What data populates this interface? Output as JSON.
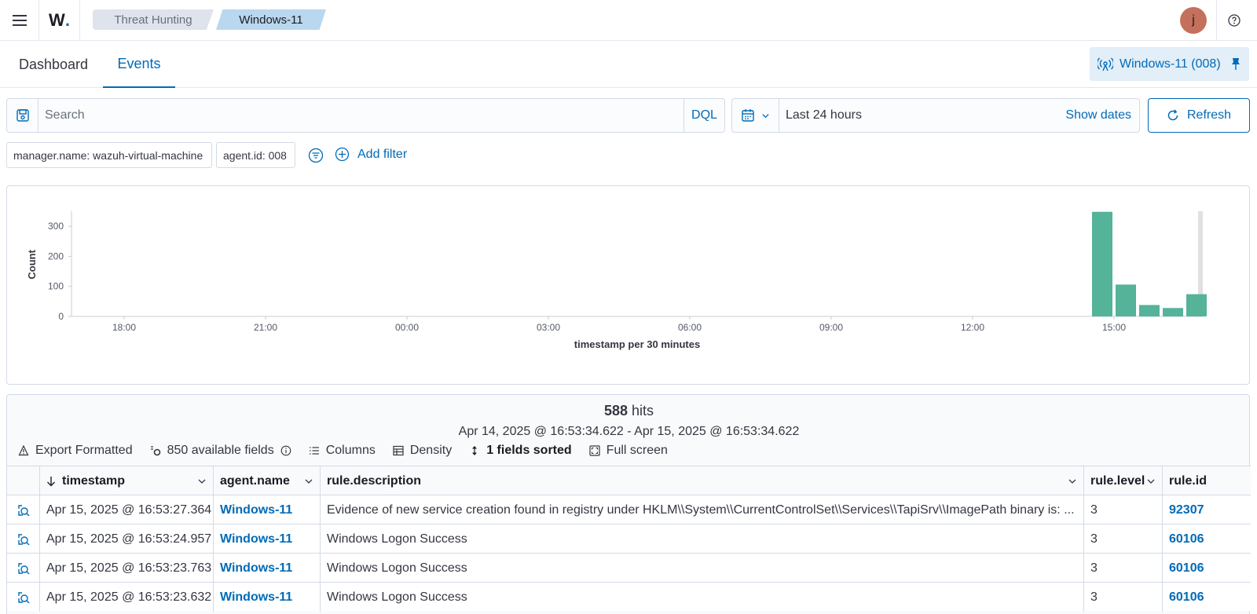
{
  "header": {
    "logo_text": "W",
    "breadcrumbs": [
      "Threat Hunting",
      "Windows-11"
    ],
    "avatar_initial": "j"
  },
  "tabs": [
    {
      "label": "Dashboard",
      "active": false
    },
    {
      "label": "Events",
      "active": true
    }
  ],
  "pinned_agent": "Windows-11 (008)",
  "search": {
    "placeholder": "Search",
    "language": "DQL",
    "date_range": "Last 24 hours",
    "show_dates_label": "Show dates",
    "refresh_label": "Refresh"
  },
  "filters": {
    "pills": [
      "manager.name: wazuh-virtual-machine",
      "agent.id: 008"
    ],
    "add_filter_label": "Add filter"
  },
  "chart_data": {
    "type": "bar",
    "title": "",
    "xlabel": "timestamp per 30 minutes",
    "ylabel": "Count",
    "ylim": [
      0,
      350
    ],
    "yticks": [
      0,
      100,
      200,
      300
    ],
    "xticks": [
      "18:00",
      "21:00",
      "00:00",
      "03:00",
      "06:00",
      "09:00",
      "12:00",
      "15:00"
    ],
    "x": [
      "14:30",
      "15:00",
      "15:30",
      "16:00",
      "16:30"
    ],
    "values": [
      348,
      106,
      38,
      28,
      74
    ],
    "color": "#54b399"
  },
  "results": {
    "hits_count": "588",
    "hits_label": "hits",
    "range": "Apr 14, 2025 @ 16:53:34.622 - Apr 15, 2025 @ 16:53:34.622",
    "toolbar": {
      "export": "Export Formatted",
      "fields": "850 available fields",
      "columns": "Columns",
      "density": "Density",
      "sorted": "1 fields sorted",
      "fullscreen": "Full screen"
    },
    "columns": [
      "timestamp",
      "agent.name",
      "rule.description",
      "rule.level",
      "rule.id"
    ],
    "rows": [
      {
        "timestamp": "Apr 15, 2025 @ 16:53:27.364",
        "agent": "Windows-11",
        "description": "Evidence of new service creation found in registry under HKLM\\\\System\\\\CurrentControlSet\\\\Services\\\\TapiSrv\\\\ImagePath binary is: ...",
        "level": "3",
        "id": "92307"
      },
      {
        "timestamp": "Apr 15, 2025 @ 16:53:24.957",
        "agent": "Windows-11",
        "description": "Windows Logon Success",
        "level": "3",
        "id": "60106"
      },
      {
        "timestamp": "Apr 15, 2025 @ 16:53:23.763",
        "agent": "Windows-11",
        "description": "Windows Logon Success",
        "level": "3",
        "id": "60106"
      },
      {
        "timestamp": "Apr 15, 2025 @ 16:53:23.632",
        "agent": "Windows-11",
        "description": "Windows Logon Success",
        "level": "3",
        "id": "60106"
      }
    ]
  }
}
